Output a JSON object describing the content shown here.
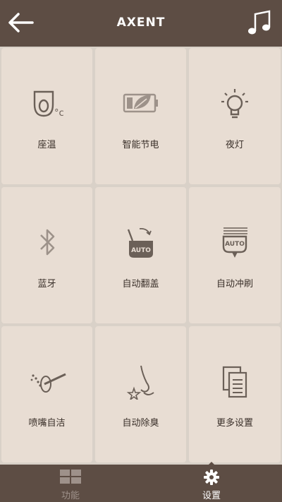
{
  "header": {
    "title": "AXENT",
    "back_icon": "arrow-left-icon",
    "music_icon": "music-note-icon"
  },
  "tiles": [
    {
      "label": "座温",
      "icon": "seat-temperature-icon"
    },
    {
      "label": "智能节电",
      "icon": "battery-leaf-icon"
    },
    {
      "label": "夜灯",
      "icon": "light-bulb-icon"
    },
    {
      "label": "蓝牙",
      "icon": "bluetooth-icon"
    },
    {
      "label": "自动翻盖",
      "icon": "auto-lid-icon"
    },
    {
      "label": "自动冲刷",
      "icon": "auto-flush-icon"
    },
    {
      "label": "喷嘴自洁",
      "icon": "nozzle-clean-icon"
    },
    {
      "label": "自动除臭",
      "icon": "deodorize-icon"
    },
    {
      "label": "更多设置",
      "icon": "more-settings-icon"
    }
  ],
  "icon_text": {
    "temp_unit": "°c",
    "auto": "AUTO"
  },
  "tabs": [
    {
      "label": "功能",
      "icon": "grid-icon",
      "active": false
    },
    {
      "label": "设置",
      "icon": "gear-icon",
      "active": true
    }
  ],
  "colors": {
    "header_bg": "#5d4d44",
    "tile_bg": "#e8ddd3",
    "grid_gap": "#d9d1c8",
    "icon_color": "#6b6058",
    "tab_active": "#ffffff",
    "tab_inactive": "#9e918a"
  }
}
